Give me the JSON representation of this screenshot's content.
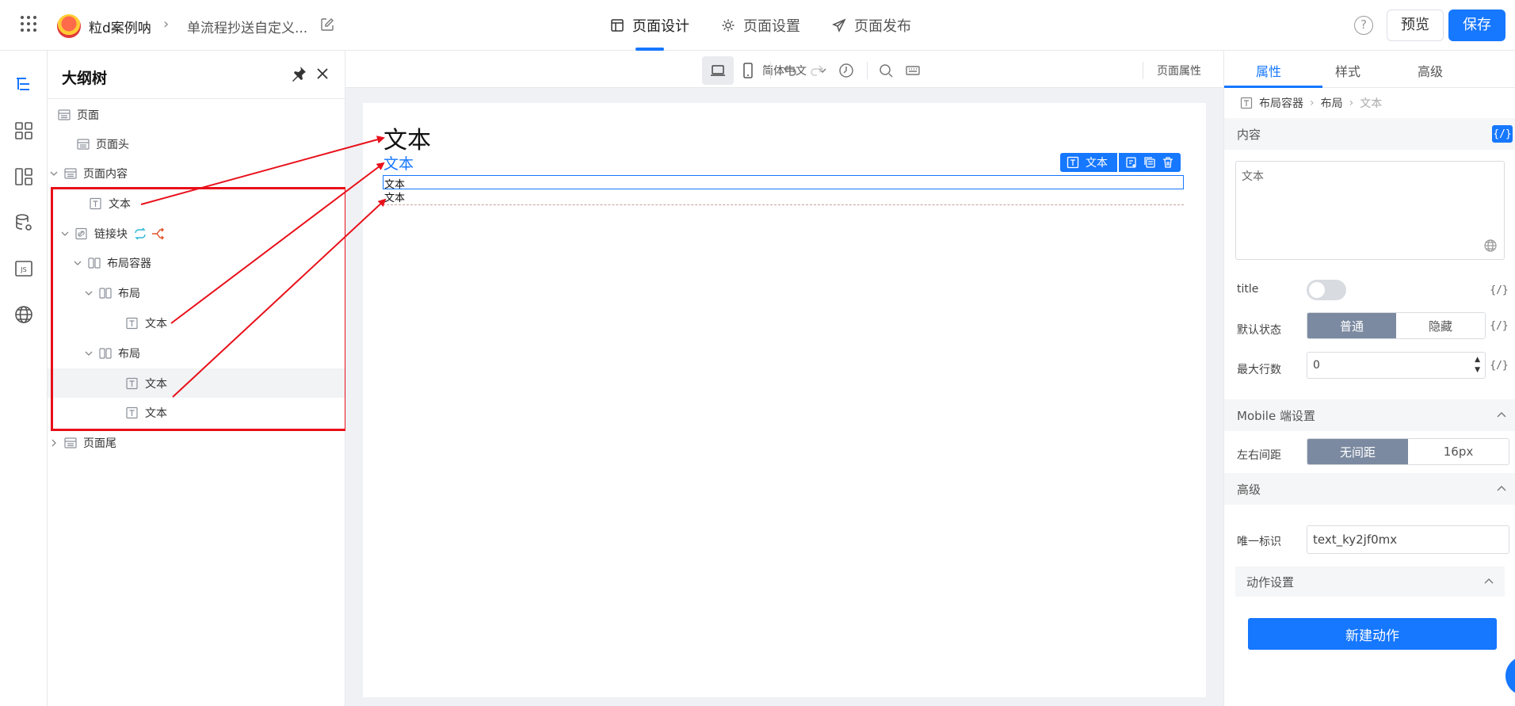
{
  "header": {
    "app_name": "粒d案例呐",
    "page_name": "单流程抄送自定义...",
    "tabs": [
      {
        "label": "页面设计",
        "icon": "layout-icon",
        "active": true
      },
      {
        "label": "页面设置",
        "icon": "gear-icon",
        "active": false
      },
      {
        "label": "页面发布",
        "icon": "send-icon",
        "active": false
      }
    ],
    "preview_label": "预览",
    "save_label": "保存",
    "help_glyph": "?"
  },
  "rail": {
    "items": [
      "outline-tree-icon",
      "components-grid-icon",
      "templates-icon",
      "datasource-icon",
      "js-icon",
      "globe-icon"
    ]
  },
  "tree": {
    "title": "大纲树",
    "rows": [
      {
        "label": "页面",
        "icon": "page-icon"
      },
      {
        "label": "页面头",
        "icon": "page-icon"
      },
      {
        "label": "页面内容",
        "icon": "page-icon",
        "expanded": true
      },
      {
        "label": "文本",
        "icon": "text-icon"
      },
      {
        "label": "链接块",
        "icon": "link-icon",
        "expanded": true
      },
      {
        "label": "布局容器",
        "icon": "layout-container-icon",
        "expanded": true
      },
      {
        "label": "布局",
        "icon": "layout-column-icon",
        "expanded": true
      },
      {
        "label": "文本",
        "icon": "text-icon"
      },
      {
        "label": "布局",
        "icon": "layout-column-icon",
        "expanded": true
      },
      {
        "label": "文本",
        "icon": "text-icon",
        "selected": true
      },
      {
        "label": "文本",
        "icon": "text-icon"
      },
      {
        "label": "页面尾",
        "icon": "page-icon",
        "expanded": false
      }
    ]
  },
  "canvas": {
    "language": "简体中文",
    "page_attr_label": "页面属性",
    "text_big": "文本",
    "text_link": "文本",
    "text_row1": "文本",
    "text_row2": "文本",
    "selection_tag": "文本"
  },
  "props": {
    "tabs": [
      {
        "label": "属性",
        "active": true
      },
      {
        "label": "样式",
        "active": false
      },
      {
        "label": "高级",
        "active": false
      }
    ],
    "breadcrumb": [
      "布局容器",
      "布局",
      "文本"
    ],
    "content_section": "内容",
    "content_value": "文本",
    "code_glyph": "{/}",
    "title_label": "title",
    "title_toggle_on": false,
    "default_state_label": "默认状态",
    "default_state_options": [
      "普通",
      "隐藏"
    ],
    "default_state_selected": "普通",
    "max_lines_label": "最大行数",
    "max_lines_value": "0",
    "mobile_section": "Mobile 端设置",
    "padding_label": "左右间距",
    "padding_options": [
      "无间距",
      "16px"
    ],
    "padding_selected": "无间距",
    "advanced_section": "高级",
    "uid_label": "唯一标识",
    "uid_value": "text_ky2jf0mx",
    "action_section": "动作设置",
    "new_action_label": "新建动作"
  },
  "colors": {
    "accent": "#1677ff",
    "annotation_red": "#e8101a",
    "segment_selected": "#7b8aa0"
  }
}
